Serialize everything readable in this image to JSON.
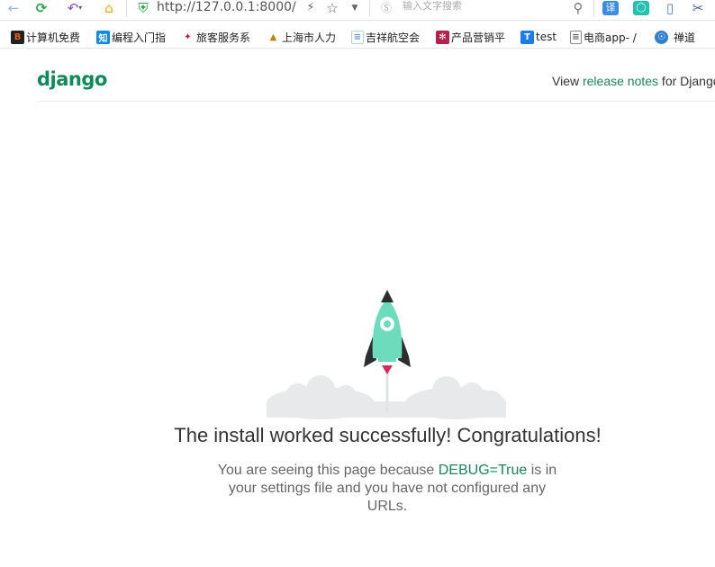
{
  "browser": {
    "url": "http://127.0.0.1:8000/",
    "search_placeholder": "输入文字搜索"
  },
  "bookmarks": [
    {
      "label": "计算机免费",
      "icon": "b-logo-icon"
    },
    {
      "label": "编程入门指",
      "icon": "zhihu-icon"
    },
    {
      "label": "旅客服务系",
      "icon": "airline-icon"
    },
    {
      "label": "上海市人力",
      "icon": "emblem-icon"
    },
    {
      "label": "吉祥航空会",
      "icon": "document-icon"
    },
    {
      "label": "产品营销平",
      "icon": "brand-icon"
    },
    {
      "label": "test",
      "icon": "t-logo-icon"
    },
    {
      "label": "电商app- /",
      "icon": "page-icon"
    },
    {
      "label": "禅道",
      "icon": "globe-icon"
    }
  ],
  "page": {
    "logo": "django",
    "notes_prefix": "View ",
    "notes_link": "release notes",
    "notes_suffix": " for Django",
    "headline": "The install worked successfully! Congratulations!",
    "sub_prefix": "You are seeing this page because ",
    "sub_code": "DEBUG=True",
    "sub_suffix": " is in your settings file and you have not configured any URLs."
  },
  "colors": {
    "brand_green": "#19865c",
    "rocket_body": "#6ddcbd",
    "rocket_dark": "#2b2e2d",
    "flame": "#d62a5c",
    "cloud": "#e8e9ea"
  }
}
